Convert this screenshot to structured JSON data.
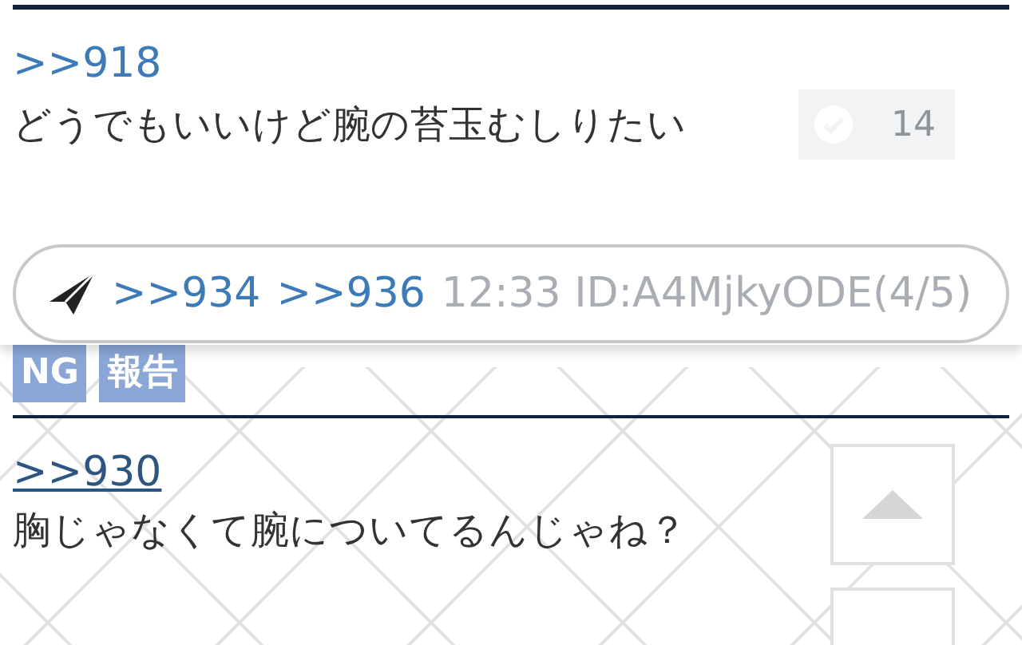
{
  "top_post": {
    "anchor": ">>918",
    "body": "どうでもいいけど腕の苔玉むしりたい",
    "like_count": "14"
  },
  "reply_bar": {
    "anchors": [
      ">>934",
      ">>936"
    ],
    "meta_behind": "12:33 ID:A4MjkyODE(4/5)"
  },
  "tags": [
    "NG",
    "報告"
  ],
  "post": {
    "anchor": ">>930",
    "body": "胸じゃなくて腕についてるんじゃね？"
  }
}
